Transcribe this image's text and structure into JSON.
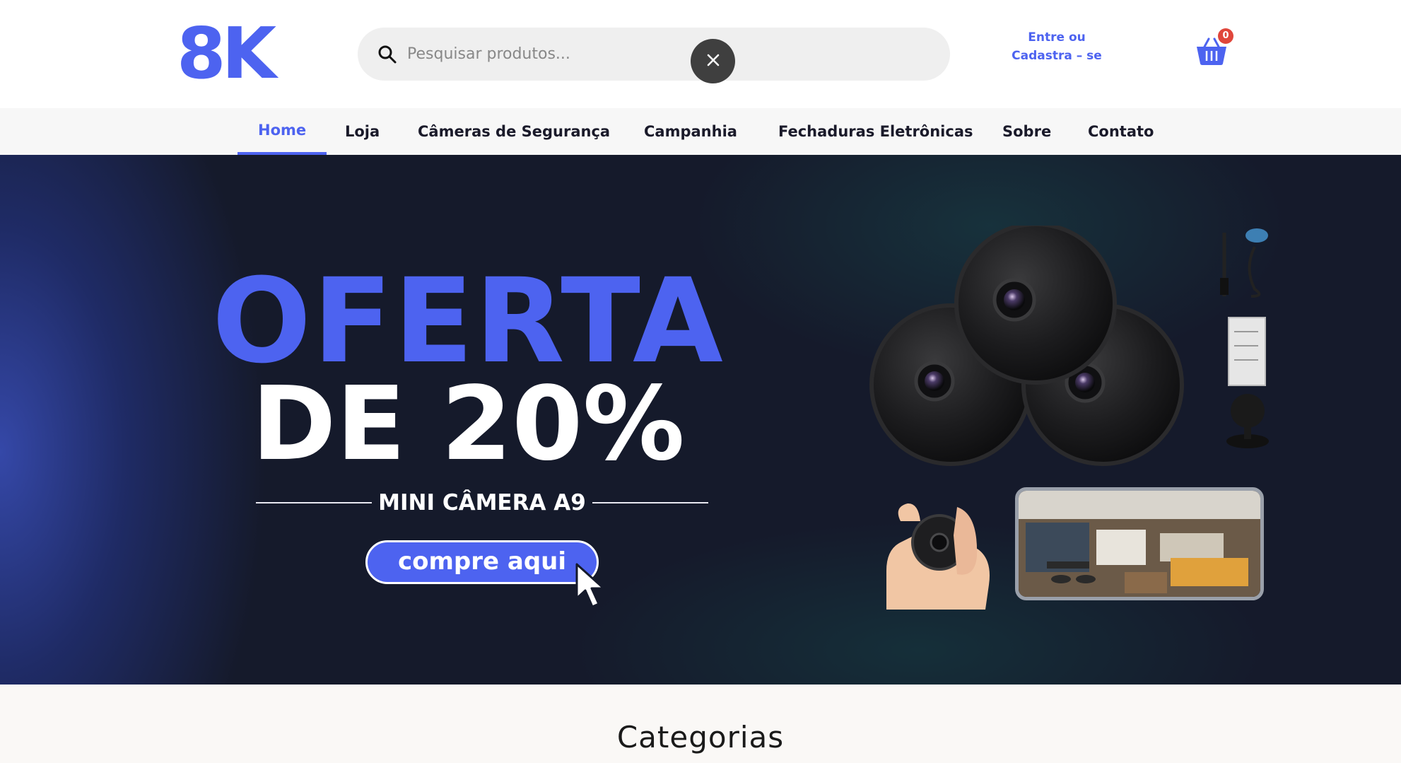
{
  "header": {
    "logo_text": "8K",
    "search_placeholder": "Pesquisar produtos...",
    "login_line1": "Entre ou",
    "login_line2": "Cadastra – se",
    "cart_count": "0"
  },
  "nav": {
    "items": [
      {
        "label": "Home",
        "active": true
      },
      {
        "label": "Loja"
      },
      {
        "label": "Câmeras de Segurança"
      },
      {
        "label": "Campanhia"
      },
      {
        "label": "Fechaduras Eletrônicas"
      },
      {
        "label": "Sobre"
      },
      {
        "label": "Contato"
      }
    ]
  },
  "hero": {
    "title_line1": "OFERTA",
    "title_line2": "DE 20%",
    "subtitle": "MINI CÂMERA A9",
    "cta_label": "compre aqui"
  },
  "categories": {
    "title": "Categorias"
  },
  "colors": {
    "accent": "#4d63f0",
    "hero_bg": "#151a2b",
    "badge": "#e0463b"
  },
  "icons": [
    "search-icon",
    "close-icon",
    "cart-icon",
    "cursor-icon"
  ]
}
